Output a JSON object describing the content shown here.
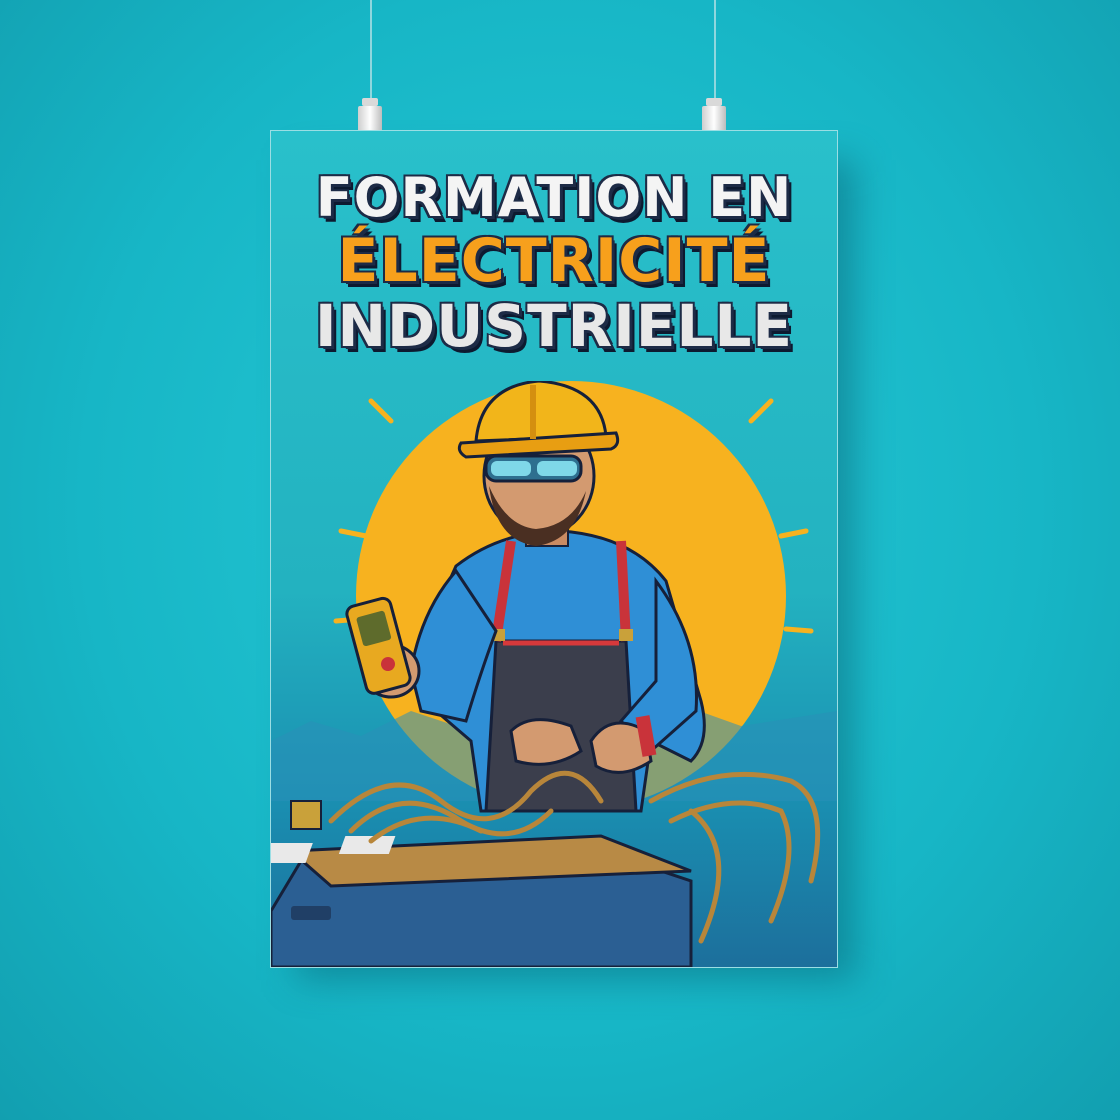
{
  "poster": {
    "title_line1": "FORMATION EN",
    "title_line2": "ÉLECTRICITÉ",
    "title_line3": "INDUSTRIELLE"
  },
  "colors": {
    "wall": "#1cbccb",
    "sun": "#f7b21f",
    "title_accent": "#f7a01c",
    "helmet": "#f2b51a",
    "shirt": "#2f8fd6"
  },
  "icons": [
    "hard-hat-icon",
    "multimeter-icon",
    "sun-burst-icon"
  ]
}
